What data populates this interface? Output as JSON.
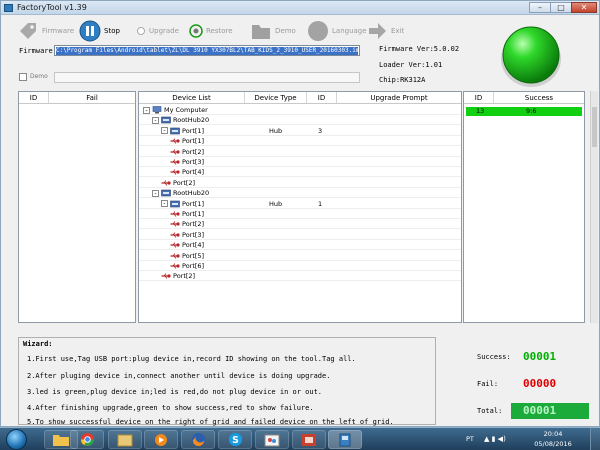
{
  "window": {
    "title": "FactoryTool v1.39",
    "min": "–",
    "max": "□",
    "close": "✕"
  },
  "toolbar": {
    "firmware": "Firmware",
    "stop": "Stop",
    "upgrade": "Upgrade",
    "restore": "Restore",
    "demo": "Demo",
    "language": "Language",
    "exit": "Exit"
  },
  "firmware": {
    "label": "Firmware",
    "path": "C:\\Program Files\\Android\\tablet\\ZL\\DL 3910 YX307BL2\\TAB_KIDS_2_3910_USER_20160303.img"
  },
  "demo": {
    "label": "Demo",
    "value": ""
  },
  "info": {
    "firmware_ver": "Firmware Ver:5.0.02",
    "loader_ver": "Loader Ver:1.01",
    "chip": "Chip:RK312A"
  },
  "colors": {
    "led": "#1fc41f",
    "success_row": "#11d011",
    "success_count": "#00b000",
    "fail_count": "#e00000"
  },
  "fail_table": {
    "columns": [
      "ID",
      "Fail"
    ],
    "rows": []
  },
  "device_table": {
    "columns": [
      "Device List",
      "Device Type",
      "ID",
      "Upgrade Prompt"
    ],
    "rows": [
      {
        "name": "My Computer",
        "type": "",
        "id": "",
        "prompt": "",
        "level": 0,
        "icon": "computer",
        "expand": "-"
      },
      {
        "name": "RootHub20",
        "type": "",
        "id": "",
        "prompt": "",
        "level": 1,
        "icon": "hub",
        "expand": "-"
      },
      {
        "name": "Port[1]",
        "type": "Hub",
        "id": "3",
        "prompt": "",
        "level": 2,
        "icon": "hub",
        "expand": "-"
      },
      {
        "name": "Port[1]",
        "type": "",
        "id": "",
        "prompt": "",
        "level": 3,
        "icon": "usb",
        "expand": ""
      },
      {
        "name": "Port[2]",
        "type": "",
        "id": "",
        "prompt": "",
        "level": 3,
        "icon": "usb",
        "expand": ""
      },
      {
        "name": "Port[3]",
        "type": "",
        "id": "",
        "prompt": "",
        "level": 3,
        "icon": "usb",
        "expand": ""
      },
      {
        "name": "Port[4]",
        "type": "",
        "id": "",
        "prompt": "",
        "level": 3,
        "icon": "usb",
        "expand": ""
      },
      {
        "name": "Port[2]",
        "type": "",
        "id": "",
        "prompt": "",
        "level": 2,
        "icon": "usb",
        "expand": ""
      },
      {
        "name": "RootHub20",
        "type": "",
        "id": "",
        "prompt": "",
        "level": 1,
        "icon": "hub",
        "expand": "-"
      },
      {
        "name": "Port[1]",
        "type": "Hub",
        "id": "1",
        "prompt": "",
        "level": 2,
        "icon": "hub",
        "expand": "-"
      },
      {
        "name": "Port[1]",
        "type": "",
        "id": "",
        "prompt": "",
        "level": 3,
        "icon": "usb",
        "expand": ""
      },
      {
        "name": "Port[2]",
        "type": "",
        "id": "",
        "prompt": "",
        "level": 3,
        "icon": "usb",
        "expand": ""
      },
      {
        "name": "Port[3]",
        "type": "",
        "id": "",
        "prompt": "",
        "level": 3,
        "icon": "usb",
        "expand": ""
      },
      {
        "name": "Port[4]",
        "type": "",
        "id": "",
        "prompt": "",
        "level": 3,
        "icon": "usb",
        "expand": ""
      },
      {
        "name": "Port[5]",
        "type": "",
        "id": "",
        "prompt": "",
        "level": 3,
        "icon": "usb",
        "expand": ""
      },
      {
        "name": "Port[6]",
        "type": "",
        "id": "",
        "prompt": "",
        "level": 3,
        "icon": "usb",
        "expand": ""
      },
      {
        "name": "Port[2]",
        "type": "",
        "id": "",
        "prompt": "",
        "level": 2,
        "icon": "usb",
        "expand": ""
      }
    ]
  },
  "success_table": {
    "columns": [
      "ID",
      "Success"
    ],
    "rows": [
      {
        "id": "13",
        "value": "9:6"
      }
    ]
  },
  "wizard": {
    "title": "Wizard:",
    "steps": [
      "1.First use,Tag USB port:plug device in,record ID showing on the tool.Tag all.",
      "2.After pluging device in,connect another until device is doing upgrade.",
      "3.led is green,plug device in;led is red,do not plug device in or out.",
      "4.After finishing upgrade,green to show success,red to show failure.",
      "5.To show successful device on the right of grid and failed device on the left of grid."
    ]
  },
  "counts": {
    "success_label": "Success:",
    "success": "00001",
    "fail_label": "Fail:",
    "fail": "00000",
    "total_label": "Total:",
    "total": "00001"
  },
  "taskbar": {
    "apps": [
      "folder-icon",
      "chrome-icon",
      "explorer-icon",
      "media-icon",
      "firefox-icon",
      "skype-icon",
      "paint-icon",
      "presentation-icon",
      "factorytool-icon"
    ],
    "lang": "PT",
    "tray": "▲ ▮ ◀)",
    "time": "20:04",
    "date": "05/08/2016"
  }
}
